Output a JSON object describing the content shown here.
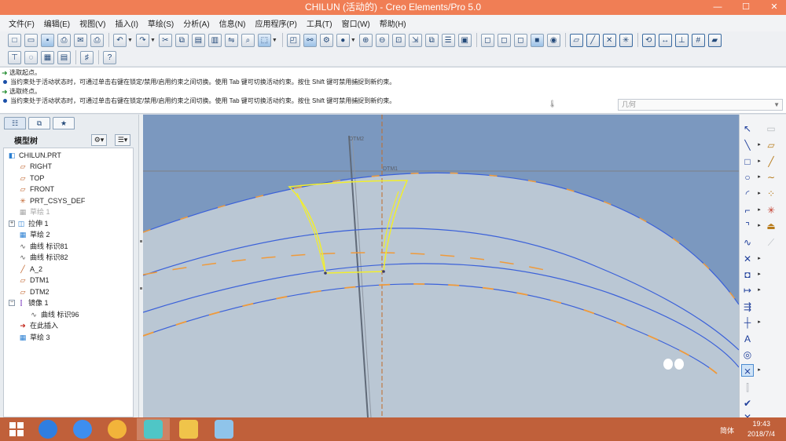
{
  "window": {
    "title": "CHILUN (活动的) - Creo Elements/Pro 5.0",
    "minimize": "—",
    "maximize": "☐",
    "close": "✕"
  },
  "menu": [
    "文件(F)",
    "编辑(E)",
    "视图(V)",
    "插入(I)",
    "草绘(S)",
    "分析(A)",
    "信息(N)",
    "应用程序(P)",
    "工具(T)",
    "窗口(W)",
    "帮助(H)"
  ],
  "messages": [
    {
      "kind": "prompt",
      "text": "选取起点。"
    },
    {
      "kind": "info",
      "text": "当约束处于活动状态时，可通过单击右键在锁定/禁用/启用约束之间切换。使用 Tab 键可切换活动约束。按住 Shift 键可禁用捕捉到新约束。"
    },
    {
      "kind": "prompt",
      "text": "选取终点。"
    },
    {
      "kind": "info",
      "text": "当约束处于活动状态时，可通过单击右键在锁定/禁用/启用约束之间切换。使用 Tab 键可切换活动约束。按住 Shift 键可禁用捕捉到新约束。"
    }
  ],
  "filter": {
    "value": "几何"
  },
  "model_tree": {
    "header": "模型树",
    "items": [
      {
        "label": "CHILUN.PRT",
        "icon": "part-icon",
        "level": 0,
        "dim": false
      },
      {
        "label": "RIGHT",
        "icon": "datum-plane-icon",
        "level": 1,
        "dim": false
      },
      {
        "label": "TOP",
        "icon": "datum-plane-icon",
        "level": 1,
        "dim": false
      },
      {
        "label": "FRONT",
        "icon": "datum-plane-icon",
        "level": 1,
        "dim": false
      },
      {
        "label": "PRT_CSYS_DEF",
        "icon": "csys-icon",
        "level": 1,
        "dim": false
      },
      {
        "label": "草绘 1",
        "icon": "sketch-icon",
        "level": 1,
        "dim": true
      },
      {
        "label": "拉伸 1",
        "icon": "extrude-icon",
        "level": 1,
        "dim": false,
        "expandable": true
      },
      {
        "label": "草绘 2",
        "icon": "sketch-icon",
        "level": 1,
        "dim": false
      },
      {
        "label": "曲线 标识81",
        "icon": "curve-icon",
        "level": 1,
        "dim": false
      },
      {
        "label": "曲线 标识82",
        "icon": "curve-icon",
        "level": 1,
        "dim": false
      },
      {
        "label": "A_2",
        "icon": "axis-icon",
        "level": 1,
        "dim": false
      },
      {
        "label": "DTM1",
        "icon": "datum-plane-icon",
        "level": 1,
        "dim": false
      },
      {
        "label": "DTM2",
        "icon": "datum-plane-icon",
        "level": 1,
        "dim": false
      },
      {
        "label": "镜像 1",
        "icon": "mirror-icon",
        "level": 1,
        "dim": false,
        "expanded": true
      },
      {
        "label": "曲线 标识96",
        "icon": "curve-icon",
        "level": 2,
        "dim": false
      },
      {
        "label": "在此插入",
        "icon": "insert-here-icon",
        "level": 1,
        "dim": false
      },
      {
        "label": "草绘 3",
        "icon": "sketch-icon",
        "level": 1,
        "dim": false
      }
    ]
  },
  "canvas": {
    "datum_labels": {
      "dtm1": "DTM1",
      "dtm2": "DTM2"
    },
    "colors": {
      "background": "#7b98bf",
      "body": "#bac7d4",
      "curve": "#3b61d9",
      "sketch": "#f2ee2c",
      "dim": "#f09a3a"
    }
  },
  "taskbar": {
    "apps": [
      "windows-start",
      "sogou-icon",
      "baidu-netdisk-icon",
      "paint-icon",
      "creo-icon",
      "file-explorer-icon",
      "notepad-icon"
    ],
    "ime": "简体",
    "time": "19:43",
    "date": "2018/7/4"
  }
}
